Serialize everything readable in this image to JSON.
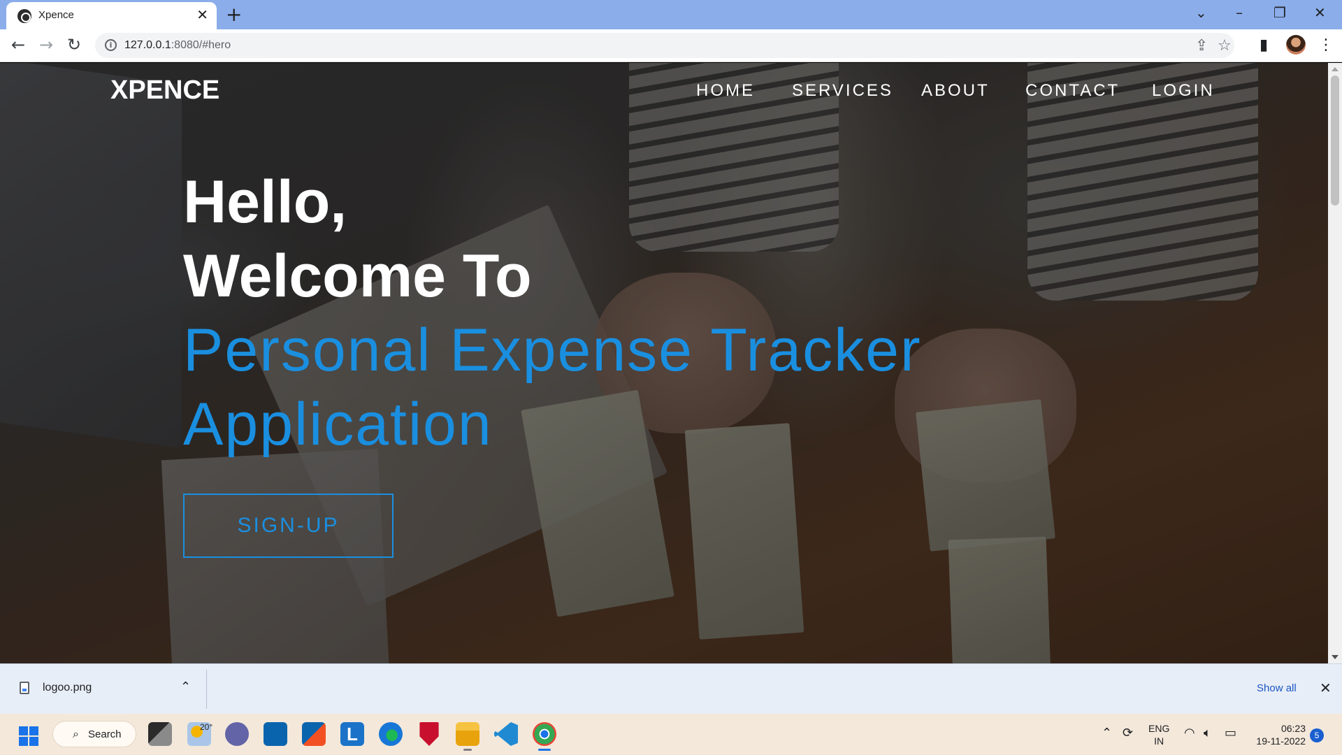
{
  "browser": {
    "tab_title": "Xpence",
    "tab_close": "✕",
    "new_tab": "+",
    "url_host": "127.0.0.1",
    "url_path": ":8080/#hero",
    "window_controls": {
      "dropdown": "⌄",
      "minimize": "–",
      "restore": "❐",
      "close": "✕"
    },
    "toolbar_icons": {
      "back": "←",
      "forward": "→",
      "reload": "↻",
      "share": "⇪",
      "bookmark": "☆",
      "side_panel": "▮",
      "menu": "⋮"
    }
  },
  "site": {
    "logo": "XPENCE",
    "nav": [
      "HOME",
      "SERVICES",
      "ABOUT",
      "CONTACT",
      "LOGIN"
    ],
    "hero": {
      "line1": "Hello,",
      "line2": "Welcome To",
      "line3": "Personal Expense Tracker",
      "line4": "Application",
      "cta": "SIGN-UP"
    },
    "colors": {
      "accent": "#1a8fe0",
      "text": "#ffffff"
    }
  },
  "downloads": {
    "file_name": "logoo.png",
    "expand": "⌃",
    "show_all": "Show all",
    "close": "✕"
  },
  "taskbar": {
    "search_label": "Search",
    "weather_temp": "20°",
    "apps": [
      "task-view",
      "weather",
      "teams",
      "mail",
      "store",
      "l-app",
      "edge",
      "mcafee",
      "file-explorer",
      "vscode",
      "chrome"
    ],
    "tray": {
      "chevron": "⌃",
      "language_top": "ENG",
      "language_bottom": "IN",
      "time": "06:23",
      "date": "19-11-2022",
      "notifications": "5"
    }
  }
}
